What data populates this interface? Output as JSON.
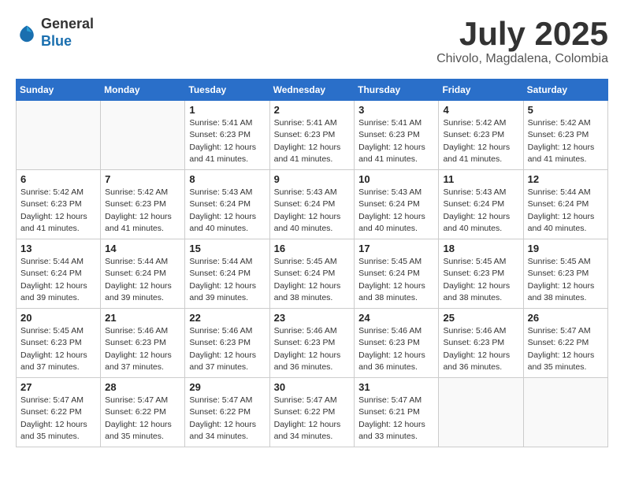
{
  "header": {
    "logo_general": "General",
    "logo_blue": "Blue",
    "month_year": "July 2025",
    "location": "Chivolo, Magdalena, Colombia"
  },
  "calendar": {
    "days_of_week": [
      "Sunday",
      "Monday",
      "Tuesday",
      "Wednesday",
      "Thursday",
      "Friday",
      "Saturday"
    ],
    "weeks": [
      [
        {
          "day": "",
          "info": ""
        },
        {
          "day": "",
          "info": ""
        },
        {
          "day": "1",
          "info": "Sunrise: 5:41 AM\nSunset: 6:23 PM\nDaylight: 12 hours and 41 minutes."
        },
        {
          "day": "2",
          "info": "Sunrise: 5:41 AM\nSunset: 6:23 PM\nDaylight: 12 hours and 41 minutes."
        },
        {
          "day": "3",
          "info": "Sunrise: 5:41 AM\nSunset: 6:23 PM\nDaylight: 12 hours and 41 minutes."
        },
        {
          "day": "4",
          "info": "Sunrise: 5:42 AM\nSunset: 6:23 PM\nDaylight: 12 hours and 41 minutes."
        },
        {
          "day": "5",
          "info": "Sunrise: 5:42 AM\nSunset: 6:23 PM\nDaylight: 12 hours and 41 minutes."
        }
      ],
      [
        {
          "day": "6",
          "info": "Sunrise: 5:42 AM\nSunset: 6:23 PM\nDaylight: 12 hours and 41 minutes."
        },
        {
          "day": "7",
          "info": "Sunrise: 5:42 AM\nSunset: 6:23 PM\nDaylight: 12 hours and 41 minutes."
        },
        {
          "day": "8",
          "info": "Sunrise: 5:43 AM\nSunset: 6:24 PM\nDaylight: 12 hours and 40 minutes."
        },
        {
          "day": "9",
          "info": "Sunrise: 5:43 AM\nSunset: 6:24 PM\nDaylight: 12 hours and 40 minutes."
        },
        {
          "day": "10",
          "info": "Sunrise: 5:43 AM\nSunset: 6:24 PM\nDaylight: 12 hours and 40 minutes."
        },
        {
          "day": "11",
          "info": "Sunrise: 5:43 AM\nSunset: 6:24 PM\nDaylight: 12 hours and 40 minutes."
        },
        {
          "day": "12",
          "info": "Sunrise: 5:44 AM\nSunset: 6:24 PM\nDaylight: 12 hours and 40 minutes."
        }
      ],
      [
        {
          "day": "13",
          "info": "Sunrise: 5:44 AM\nSunset: 6:24 PM\nDaylight: 12 hours and 39 minutes."
        },
        {
          "day": "14",
          "info": "Sunrise: 5:44 AM\nSunset: 6:24 PM\nDaylight: 12 hours and 39 minutes."
        },
        {
          "day": "15",
          "info": "Sunrise: 5:44 AM\nSunset: 6:24 PM\nDaylight: 12 hours and 39 minutes."
        },
        {
          "day": "16",
          "info": "Sunrise: 5:45 AM\nSunset: 6:24 PM\nDaylight: 12 hours and 38 minutes."
        },
        {
          "day": "17",
          "info": "Sunrise: 5:45 AM\nSunset: 6:24 PM\nDaylight: 12 hours and 38 minutes."
        },
        {
          "day": "18",
          "info": "Sunrise: 5:45 AM\nSunset: 6:23 PM\nDaylight: 12 hours and 38 minutes."
        },
        {
          "day": "19",
          "info": "Sunrise: 5:45 AM\nSunset: 6:23 PM\nDaylight: 12 hours and 38 minutes."
        }
      ],
      [
        {
          "day": "20",
          "info": "Sunrise: 5:45 AM\nSunset: 6:23 PM\nDaylight: 12 hours and 37 minutes."
        },
        {
          "day": "21",
          "info": "Sunrise: 5:46 AM\nSunset: 6:23 PM\nDaylight: 12 hours and 37 minutes."
        },
        {
          "day": "22",
          "info": "Sunrise: 5:46 AM\nSunset: 6:23 PM\nDaylight: 12 hours and 37 minutes."
        },
        {
          "day": "23",
          "info": "Sunrise: 5:46 AM\nSunset: 6:23 PM\nDaylight: 12 hours and 36 minutes."
        },
        {
          "day": "24",
          "info": "Sunrise: 5:46 AM\nSunset: 6:23 PM\nDaylight: 12 hours and 36 minutes."
        },
        {
          "day": "25",
          "info": "Sunrise: 5:46 AM\nSunset: 6:23 PM\nDaylight: 12 hours and 36 minutes."
        },
        {
          "day": "26",
          "info": "Sunrise: 5:47 AM\nSunset: 6:22 PM\nDaylight: 12 hours and 35 minutes."
        }
      ],
      [
        {
          "day": "27",
          "info": "Sunrise: 5:47 AM\nSunset: 6:22 PM\nDaylight: 12 hours and 35 minutes."
        },
        {
          "day": "28",
          "info": "Sunrise: 5:47 AM\nSunset: 6:22 PM\nDaylight: 12 hours and 35 minutes."
        },
        {
          "day": "29",
          "info": "Sunrise: 5:47 AM\nSunset: 6:22 PM\nDaylight: 12 hours and 34 minutes."
        },
        {
          "day": "30",
          "info": "Sunrise: 5:47 AM\nSunset: 6:22 PM\nDaylight: 12 hours and 34 minutes."
        },
        {
          "day": "31",
          "info": "Sunrise: 5:47 AM\nSunset: 6:21 PM\nDaylight: 12 hours and 33 minutes."
        },
        {
          "day": "",
          "info": ""
        },
        {
          "day": "",
          "info": ""
        }
      ]
    ]
  }
}
